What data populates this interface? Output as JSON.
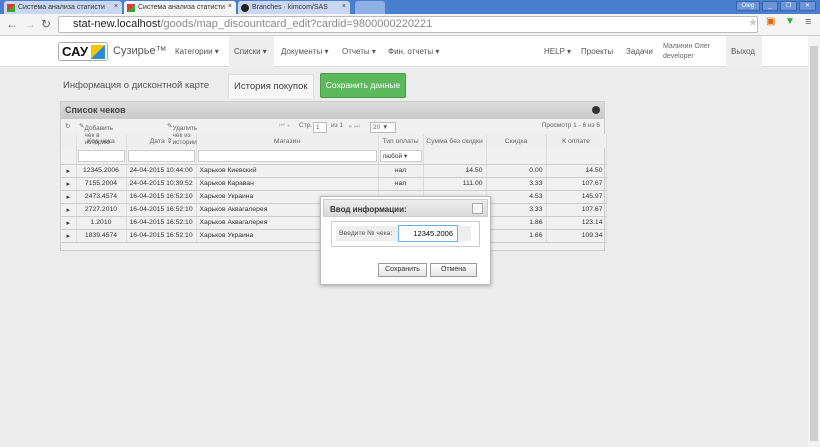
{
  "browser": {
    "tabs": [
      {
        "title": "Система анализа статисти"
      },
      {
        "title": "Система анализа статисти"
      },
      {
        "title": "Branches · kimcom/SAS"
      }
    ],
    "user_badge": "Oleg",
    "url_host": "stat-new.localhost",
    "url_path": "/goods/map_discountcard_edit?cardid=9800000220221"
  },
  "navbar": {
    "logo": "САУ",
    "brand": "Сузирье™",
    "menu": [
      "Категории ▾",
      "Списки ▾",
      "Документы ▾",
      "Отчеты ▾",
      "Фин. отчеты ▾"
    ],
    "right": [
      "HELP ▾",
      "Проекты",
      "Задачи"
    ],
    "user_name": "Малинин Олег",
    "user_role": "developer",
    "logout": "Выход"
  },
  "page_tabs": {
    "info": "Информация о дисконтной карте",
    "history": "История покупок",
    "save": "Сохранить данные"
  },
  "grid": {
    "caption": "Список чеков",
    "add": "Добавить чек в историю",
    "remove": "Удалить чек из истории",
    "page_label": "Стр.",
    "page": "1",
    "of": "из 1",
    "page_size": "20 ▼",
    "view": "Просмотр 1 - 6 из 6",
    "columns": [
      "Код чека",
      "Дата ⇕",
      "Магазин",
      "Тип оплаты",
      "Сумма без скидки",
      "Скидка",
      "К оплате"
    ],
    "filter_pay": "любой",
    "rows": [
      [
        "12345.2006",
        "24-04-2015 10:44:00",
        "Харьков Киевский",
        "нал",
        "14.50",
        "0.00",
        "14.50"
      ],
      [
        "7155.2004",
        "24-04-2015 10:39:52",
        "Харьков Караван",
        "нал",
        "111.00",
        "3.33",
        "107.67"
      ],
      [
        "2473.4574",
        "16-04-2015 16:52:10",
        "Харьков Украина",
        "",
        "",
        "4.53",
        "145.97"
      ],
      [
        "2727.2010",
        "16-04-2015 16:52:10",
        "Харьков Аквагалерея",
        "",
        "",
        "3.33",
        "107.67"
      ],
      [
        "1.2010",
        "16-04-2015 16:52:10",
        "Харьков Аквагалерея",
        "",
        "",
        "1.86",
        "123.14"
      ],
      [
        "1839.4574",
        "16-04-2015 16:52:10",
        "Харьков Украина",
        "",
        "",
        "1.66",
        "109.34"
      ]
    ]
  },
  "dialog": {
    "title": "Ввод информации:",
    "label": "Введите № чека:",
    "value": "12345.2006",
    "save": "Сохранить",
    "cancel": "Отмена"
  }
}
